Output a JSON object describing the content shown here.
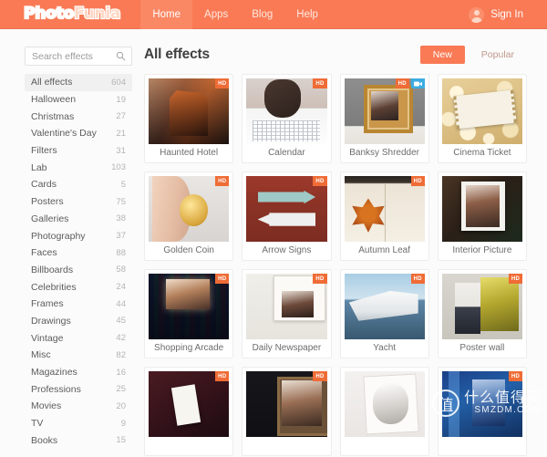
{
  "header": {
    "logo_primary": "Photo",
    "logo_secondary": "Funia",
    "nav": [
      {
        "label": "Home",
        "active": true
      },
      {
        "label": "Apps",
        "active": false
      },
      {
        "label": "Blog",
        "active": false
      },
      {
        "label": "Help",
        "active": false
      }
    ],
    "sign_in_label": "Sign In",
    "avatar_icon": "user-avatar-icon",
    "background_color": "#f97a55"
  },
  "sidebar": {
    "search": {
      "placeholder": "Search effects",
      "value": "",
      "icon": "search-icon"
    },
    "categories": [
      {
        "label": "All effects",
        "count": "604",
        "active": true
      },
      {
        "label": "Halloween",
        "count": "19",
        "active": false
      },
      {
        "label": "Christmas",
        "count": "27",
        "active": false
      },
      {
        "label": "Valentine's Day",
        "count": "21",
        "active": false
      },
      {
        "label": "Filters",
        "count": "31",
        "active": false
      },
      {
        "label": "Lab",
        "count": "103",
        "active": false
      },
      {
        "label": "Cards",
        "count": "5",
        "active": false
      },
      {
        "label": "Posters",
        "count": "75",
        "active": false
      },
      {
        "label": "Galleries",
        "count": "38",
        "active": false
      },
      {
        "label": "Photography",
        "count": "37",
        "active": false
      },
      {
        "label": "Faces",
        "count": "88",
        "active": false
      },
      {
        "label": "Billboards",
        "count": "58",
        "active": false
      },
      {
        "label": "Celebrities",
        "count": "24",
        "active": false
      },
      {
        "label": "Frames",
        "count": "44",
        "active": false
      },
      {
        "label": "Drawings",
        "count": "45",
        "active": false
      },
      {
        "label": "Vintage",
        "count": "42",
        "active": false
      },
      {
        "label": "Misc",
        "count": "82",
        "active": false
      },
      {
        "label": "Magazines",
        "count": "16",
        "active": false
      },
      {
        "label": "Professions",
        "count": "25",
        "active": false
      },
      {
        "label": "Movies",
        "count": "20",
        "active": false
      },
      {
        "label": "TV",
        "count": "9",
        "active": false
      },
      {
        "label": "Books",
        "count": "15",
        "active": false
      }
    ]
  },
  "main": {
    "title": "All effects",
    "sort_tabs": [
      {
        "label": "New",
        "active": true
      },
      {
        "label": "Popular",
        "active": false
      }
    ],
    "accent_color": "#f97a55",
    "hd_badge_color": "#ef6c36",
    "video_badge_color": "#3bace0",
    "effects": [
      {
        "name": "Haunted Hotel",
        "art": "art-haunted",
        "hd": true,
        "video": false
      },
      {
        "name": "Calendar",
        "art": "art-calendar",
        "hd": true,
        "video": false
      },
      {
        "name": "Banksy Shredder",
        "art": "art-banksy",
        "hd": true,
        "video": true
      },
      {
        "name": "Cinema Ticket",
        "art": "art-cinema",
        "hd": false,
        "video": false
      },
      {
        "name": "Golden Coin",
        "art": "art-coin",
        "hd": true,
        "video": false
      },
      {
        "name": "Arrow Signs",
        "art": "art-arrow",
        "hd": true,
        "video": false
      },
      {
        "name": "Autumn Leaf",
        "art": "art-autumn",
        "hd": true,
        "video": false
      },
      {
        "name": "Interior Picture",
        "art": "art-interior",
        "hd": false,
        "video": false
      },
      {
        "name": "Shopping Arcade",
        "art": "art-shopping",
        "hd": true,
        "video": false
      },
      {
        "name": "Daily Newspaper",
        "art": "art-news",
        "hd": true,
        "video": false
      },
      {
        "name": "Yacht",
        "art": "art-yacht",
        "hd": true,
        "video": false
      },
      {
        "name": "Poster wall",
        "art": "art-poster",
        "hd": true,
        "video": false
      },
      {
        "name": "",
        "art": "art-cards",
        "hd": true,
        "video": false
      },
      {
        "name": "",
        "art": "art-framed",
        "hd": true,
        "video": false
      },
      {
        "name": "",
        "art": "art-sketch",
        "hd": false,
        "video": false
      },
      {
        "name": "",
        "art": "art-blue",
        "hd": true,
        "video": false
      }
    ],
    "hd_badge_label": "HD",
    "video_badge_icon": "video-camera-icon"
  },
  "watermark": {
    "seal_char": "值",
    "chinese_text": "什么值得买",
    "domain_text": "SMZDM.COM"
  }
}
